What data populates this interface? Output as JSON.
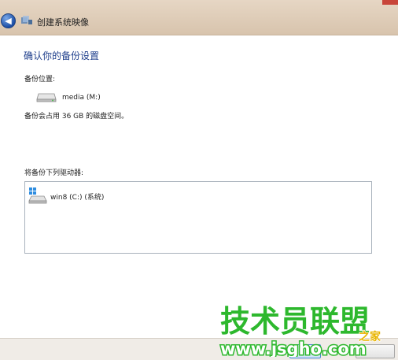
{
  "window": {
    "title": "创建系统映像",
    "back_icon": "back-arrow-icon",
    "app_icon": "windows-backup-icon"
  },
  "main": {
    "heading": "确认你的备份设置",
    "backup_location_label": "备份位置:",
    "backup_destination": {
      "icon": "hard-drive-icon",
      "name": "media (M:)"
    },
    "space_note": "备份会占用 36 GB 的磁盘空间。",
    "drives_label": "将备份下列驱动器:",
    "drives": [
      {
        "icon": "windows-drive-icon",
        "name": "win8 (C:) (系统)"
      }
    ]
  },
  "watermark": {
    "line1": "技术员联盟",
    "line2": "www.jsgho.com",
    "brand_suffix": "之家"
  },
  "colors": {
    "titlebar": "#dcc8b2",
    "heading": "#1f3f8c",
    "watermark_green": "#2db82d",
    "watermark_white": "#ffffff"
  }
}
